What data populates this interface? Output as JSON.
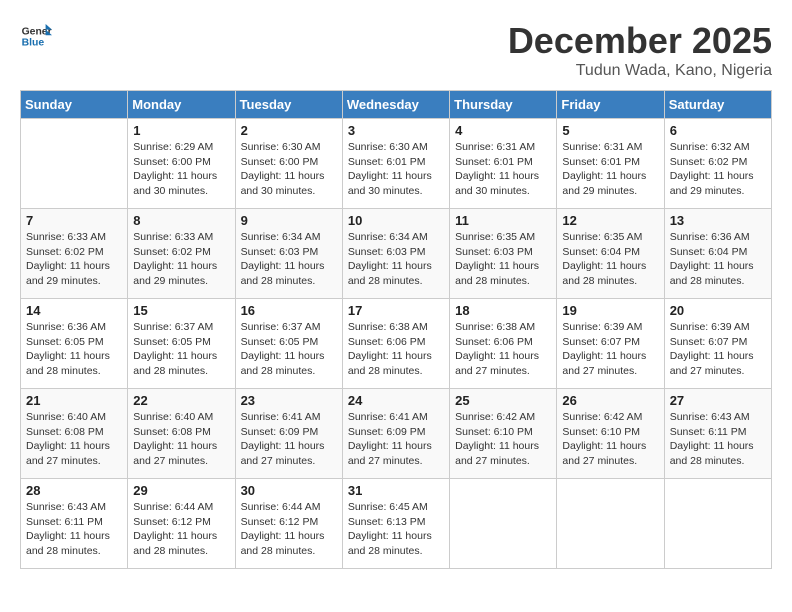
{
  "header": {
    "logo_line1": "General",
    "logo_line2": "Blue",
    "month": "December 2025",
    "location": "Tudun Wada, Kano, Nigeria"
  },
  "weekdays": [
    "Sunday",
    "Monday",
    "Tuesday",
    "Wednesday",
    "Thursday",
    "Friday",
    "Saturday"
  ],
  "weeks": [
    [
      {
        "day": "",
        "sunrise": "",
        "sunset": "",
        "daylight": ""
      },
      {
        "day": "1",
        "sunrise": "Sunrise: 6:29 AM",
        "sunset": "Sunset: 6:00 PM",
        "daylight": "Daylight: 11 hours and 30 minutes."
      },
      {
        "day": "2",
        "sunrise": "Sunrise: 6:30 AM",
        "sunset": "Sunset: 6:00 PM",
        "daylight": "Daylight: 11 hours and 30 minutes."
      },
      {
        "day": "3",
        "sunrise": "Sunrise: 6:30 AM",
        "sunset": "Sunset: 6:01 PM",
        "daylight": "Daylight: 11 hours and 30 minutes."
      },
      {
        "day": "4",
        "sunrise": "Sunrise: 6:31 AM",
        "sunset": "Sunset: 6:01 PM",
        "daylight": "Daylight: 11 hours and 30 minutes."
      },
      {
        "day": "5",
        "sunrise": "Sunrise: 6:31 AM",
        "sunset": "Sunset: 6:01 PM",
        "daylight": "Daylight: 11 hours and 29 minutes."
      },
      {
        "day": "6",
        "sunrise": "Sunrise: 6:32 AM",
        "sunset": "Sunset: 6:02 PM",
        "daylight": "Daylight: 11 hours and 29 minutes."
      }
    ],
    [
      {
        "day": "7",
        "sunrise": "Sunrise: 6:33 AM",
        "sunset": "Sunset: 6:02 PM",
        "daylight": "Daylight: 11 hours and 29 minutes."
      },
      {
        "day": "8",
        "sunrise": "Sunrise: 6:33 AM",
        "sunset": "Sunset: 6:02 PM",
        "daylight": "Daylight: 11 hours and 29 minutes."
      },
      {
        "day": "9",
        "sunrise": "Sunrise: 6:34 AM",
        "sunset": "Sunset: 6:03 PM",
        "daylight": "Daylight: 11 hours and 28 minutes."
      },
      {
        "day": "10",
        "sunrise": "Sunrise: 6:34 AM",
        "sunset": "Sunset: 6:03 PM",
        "daylight": "Daylight: 11 hours and 28 minutes."
      },
      {
        "day": "11",
        "sunrise": "Sunrise: 6:35 AM",
        "sunset": "Sunset: 6:03 PM",
        "daylight": "Daylight: 11 hours and 28 minutes."
      },
      {
        "day": "12",
        "sunrise": "Sunrise: 6:35 AM",
        "sunset": "Sunset: 6:04 PM",
        "daylight": "Daylight: 11 hours and 28 minutes."
      },
      {
        "day": "13",
        "sunrise": "Sunrise: 6:36 AM",
        "sunset": "Sunset: 6:04 PM",
        "daylight": "Daylight: 11 hours and 28 minutes."
      }
    ],
    [
      {
        "day": "14",
        "sunrise": "Sunrise: 6:36 AM",
        "sunset": "Sunset: 6:05 PM",
        "daylight": "Daylight: 11 hours and 28 minutes."
      },
      {
        "day": "15",
        "sunrise": "Sunrise: 6:37 AM",
        "sunset": "Sunset: 6:05 PM",
        "daylight": "Daylight: 11 hours and 28 minutes."
      },
      {
        "day": "16",
        "sunrise": "Sunrise: 6:37 AM",
        "sunset": "Sunset: 6:05 PM",
        "daylight": "Daylight: 11 hours and 28 minutes."
      },
      {
        "day": "17",
        "sunrise": "Sunrise: 6:38 AM",
        "sunset": "Sunset: 6:06 PM",
        "daylight": "Daylight: 11 hours and 28 minutes."
      },
      {
        "day": "18",
        "sunrise": "Sunrise: 6:38 AM",
        "sunset": "Sunset: 6:06 PM",
        "daylight": "Daylight: 11 hours and 27 minutes."
      },
      {
        "day": "19",
        "sunrise": "Sunrise: 6:39 AM",
        "sunset": "Sunset: 6:07 PM",
        "daylight": "Daylight: 11 hours and 27 minutes."
      },
      {
        "day": "20",
        "sunrise": "Sunrise: 6:39 AM",
        "sunset": "Sunset: 6:07 PM",
        "daylight": "Daylight: 11 hours and 27 minutes."
      }
    ],
    [
      {
        "day": "21",
        "sunrise": "Sunrise: 6:40 AM",
        "sunset": "Sunset: 6:08 PM",
        "daylight": "Daylight: 11 hours and 27 minutes."
      },
      {
        "day": "22",
        "sunrise": "Sunrise: 6:40 AM",
        "sunset": "Sunset: 6:08 PM",
        "daylight": "Daylight: 11 hours and 27 minutes."
      },
      {
        "day": "23",
        "sunrise": "Sunrise: 6:41 AM",
        "sunset": "Sunset: 6:09 PM",
        "daylight": "Daylight: 11 hours and 27 minutes."
      },
      {
        "day": "24",
        "sunrise": "Sunrise: 6:41 AM",
        "sunset": "Sunset: 6:09 PM",
        "daylight": "Daylight: 11 hours and 27 minutes."
      },
      {
        "day": "25",
        "sunrise": "Sunrise: 6:42 AM",
        "sunset": "Sunset: 6:10 PM",
        "daylight": "Daylight: 11 hours and 27 minutes."
      },
      {
        "day": "26",
        "sunrise": "Sunrise: 6:42 AM",
        "sunset": "Sunset: 6:10 PM",
        "daylight": "Daylight: 11 hours and 27 minutes."
      },
      {
        "day": "27",
        "sunrise": "Sunrise: 6:43 AM",
        "sunset": "Sunset: 6:11 PM",
        "daylight": "Daylight: 11 hours and 28 minutes."
      }
    ],
    [
      {
        "day": "28",
        "sunrise": "Sunrise: 6:43 AM",
        "sunset": "Sunset: 6:11 PM",
        "daylight": "Daylight: 11 hours and 28 minutes."
      },
      {
        "day": "29",
        "sunrise": "Sunrise: 6:44 AM",
        "sunset": "Sunset: 6:12 PM",
        "daylight": "Daylight: 11 hours and 28 minutes."
      },
      {
        "day": "30",
        "sunrise": "Sunrise: 6:44 AM",
        "sunset": "Sunset: 6:12 PM",
        "daylight": "Daylight: 11 hours and 28 minutes."
      },
      {
        "day": "31",
        "sunrise": "Sunrise: 6:45 AM",
        "sunset": "Sunset: 6:13 PM",
        "daylight": "Daylight: 11 hours and 28 minutes."
      },
      {
        "day": "",
        "sunrise": "",
        "sunset": "",
        "daylight": ""
      },
      {
        "day": "",
        "sunrise": "",
        "sunset": "",
        "daylight": ""
      },
      {
        "day": "",
        "sunrise": "",
        "sunset": "",
        "daylight": ""
      }
    ]
  ]
}
